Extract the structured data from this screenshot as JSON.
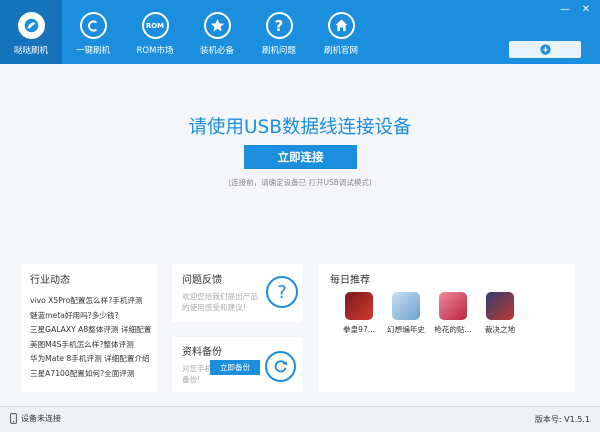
{
  "nav": [
    {
      "label": "哒哒刷机",
      "icon": "logo-icon"
    },
    {
      "label": "一键刷机",
      "icon": "c-icon"
    },
    {
      "label": "ROM市场",
      "icon": "rom-icon"
    },
    {
      "label": "装机必备",
      "icon": "star-icon"
    },
    {
      "label": "刷机问题",
      "icon": "question-icon"
    },
    {
      "label": "刷机官网",
      "icon": "home-icon"
    }
  ],
  "nav_rom_text": "ROM",
  "window": {
    "minimize": "—",
    "close": "✕"
  },
  "hero": {
    "title": "请使用USB数据线连接设备",
    "connect_button": "立即连接",
    "hint": "(连接前，请确定设备已 打开USB调试模式)"
  },
  "news": {
    "title": "行业动态",
    "items": [
      "vivo X5Pro配置怎么样?手机评测",
      "魅蓝meta好用吗?多少钱?",
      "三星GALAXY A8整体评测 详细配置",
      "美图M4S手机怎么样?整体评测",
      "华为Mate 8手机评测 详细配置介绍",
      "三星A7100配置如何?全面评测"
    ]
  },
  "feedback": {
    "title": "问题反馈",
    "text_line1": "欢迎您给我们提出产品",
    "text_line2": "的使用感受和建议!",
    "icon_glyph": "?"
  },
  "backup": {
    "title": "资料备份",
    "text_line1": "对您手机",
    "text_line2": "备份!",
    "button": "立即备份"
  },
  "daily": {
    "title": "每日推荐",
    "apps": [
      {
        "name": "拳皇97...",
        "color": "#b5262c"
      },
      {
        "name": "幻想编年史",
        "color": "#8fb8df"
      },
      {
        "name": "枪花的贴...",
        "color": "#d93c5a"
      },
      {
        "name": "裁决之地",
        "color": "#c0392b"
      }
    ]
  },
  "status": {
    "device": "设备未连接",
    "version": "版本号: V1.5.1"
  },
  "colors": {
    "brand": "#1b8fde",
    "brand_dark": "#1573bc"
  }
}
